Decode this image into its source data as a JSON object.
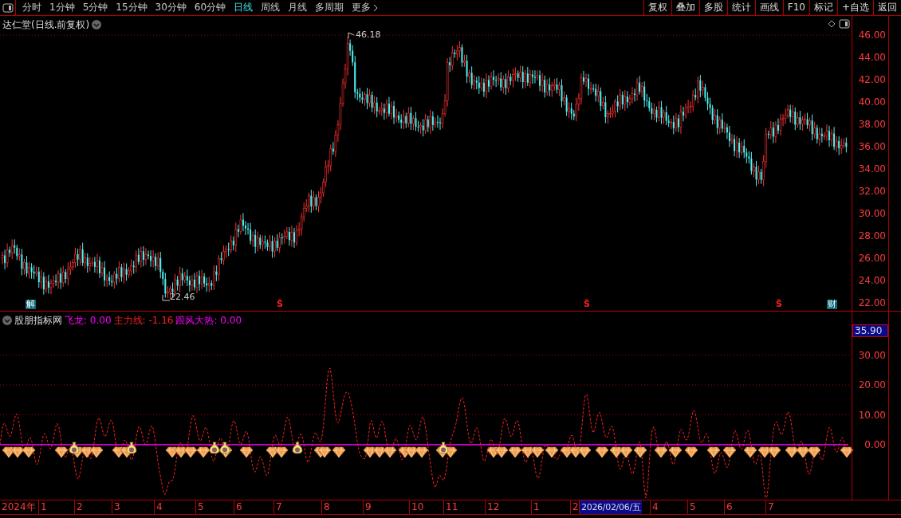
{
  "toolbar": {
    "tabs": [
      {
        "label": "分时",
        "selected": false
      },
      {
        "label": "1分钟",
        "selected": false
      },
      {
        "label": "5分钟",
        "selected": false
      },
      {
        "label": "15分钟",
        "selected": false
      },
      {
        "label": "30分钟",
        "selected": false
      },
      {
        "label": "60分钟",
        "selected": false
      },
      {
        "label": "日线",
        "selected": true
      },
      {
        "label": "周线",
        "selected": false
      },
      {
        "label": "月线",
        "selected": false
      },
      {
        "label": "多周期",
        "selected": false
      }
    ],
    "more": "更多",
    "buttons": [
      "复权",
      "叠加",
      "多股",
      "统计",
      "画线",
      "F10",
      "标记",
      "+自选",
      "返回"
    ]
  },
  "chart_title": "达仁堂(日线.前复权)",
  "price_marks": [
    {
      "text": "46.18",
      "kind": "high"
    },
    {
      "text": "22.46",
      "kind": "low"
    }
  ],
  "event_marks": [
    {
      "text": "解",
      "kind": "box"
    },
    {
      "text": "Ŝ",
      "kind": "signal"
    },
    {
      "text": "Ŝ",
      "kind": "signal"
    },
    {
      "text": "Ŝ",
      "kind": "signal"
    },
    {
      "text": "财",
      "kind": "box"
    }
  ],
  "price_axis": [
    "46.00",
    "44.00",
    "42.00",
    "40.00",
    "38.00",
    "36.00",
    "34.00",
    "32.00",
    "30.00",
    "28.00",
    "26.00",
    "24.00",
    "22.00"
  ],
  "indicator": {
    "name": "股朋指标网",
    "values": [
      {
        "label": "飞龙: 0.00",
        "color": "#ff00ff"
      },
      {
        "label": "主力线: -1.16",
        "color": "#ff2020"
      },
      {
        "label": "跟风大热: 0.00",
        "color": "#ff00ff"
      }
    ],
    "axis": [
      "30.00",
      "20.00",
      "10.00",
      "0.00"
    ],
    "cursor_value": "35.90"
  },
  "timeline": {
    "year": "2024年",
    "months": [
      {
        "text": "1",
        "kind": "month"
      },
      {
        "text": "2",
        "kind": "month"
      },
      {
        "text": "3",
        "kind": "month"
      },
      {
        "text": "4",
        "kind": "month"
      },
      {
        "text": "5",
        "kind": "month"
      },
      {
        "text": "6",
        "kind": "month"
      },
      {
        "text": "7",
        "kind": "month"
      },
      {
        "text": "8",
        "kind": "month"
      },
      {
        "text": "9",
        "kind": "month"
      },
      {
        "text": "10",
        "kind": "month"
      },
      {
        "text": "11",
        "kind": "month"
      },
      {
        "text": "12",
        "kind": "month"
      },
      {
        "text": "1",
        "kind": "month"
      },
      {
        "text": "2",
        "kind": "month"
      },
      {
        "text": "2026/02/06/五",
        "kind": "cursor"
      },
      {
        "text": "4",
        "kind": "month"
      },
      {
        "text": "5",
        "kind": "month"
      },
      {
        "text": "6",
        "kind": "month"
      },
      {
        "text": "7",
        "kind": "month"
      }
    ]
  }
}
